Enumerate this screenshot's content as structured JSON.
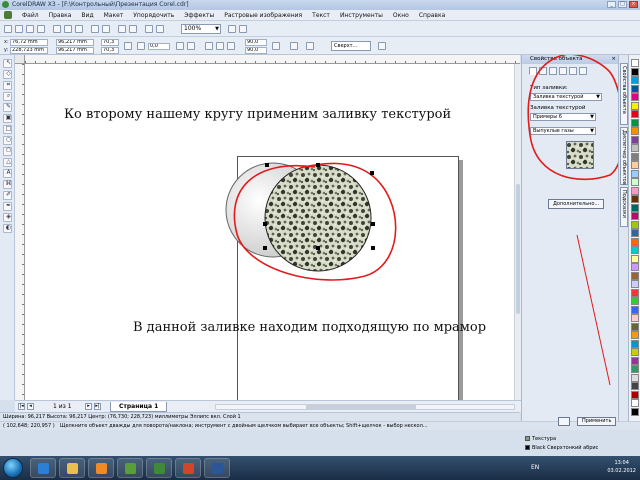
{
  "window": {
    "title": "CorelDRAW X3 - [F:\\Контрольный\\Презентация Corel.cdr]",
    "controls": [
      "_",
      "□",
      "×"
    ]
  },
  "menu": [
    "Файл",
    "Правка",
    "Вид",
    "Макет",
    "Упорядочить",
    "Эффекты",
    "Растровые изображения",
    "Текст",
    "Инструменты",
    "Окно",
    "Справка"
  ],
  "property_bar": {
    "zoom": "100%",
    "x": "76,72 mm",
    "y": "228,723 mm",
    "width": "96,217 mm",
    "height": "96,217 mm",
    "scale_w": "70,3",
    "scale_h": "70,3",
    "angle": "0,0",
    "arc_start": "90,0",
    "arc_end": "90,0",
    "outline_style": "Сверхт..."
  },
  "canvas": {
    "caption_top": "Ко второму нашему кругу применим заливку текстурой",
    "caption_bottom": "В данной заливке находим подходящую по мрамор"
  },
  "page_nav": {
    "count": "1 из 1",
    "tab": "Страница 1",
    "first": "|◂",
    "prev": "◂",
    "next": "▸",
    "last": "▸|"
  },
  "status": {
    "line1": "Ширина: 96,217 Высота: 96,217 Центр: (76,730; 228,723) миллиметры      Эллипс вкл. Слой 1",
    "coords": "( 102,648; 220,957 )",
    "hint": "Щелкните объект дважды для поворота/наклона; инструмент с двойным щелчком выбирает все объекты; Shift+щелчок - выбор нескол...",
    "fill_name": "Текстура",
    "outline_name": "Black  Сверхтонкий абрис"
  },
  "docker": {
    "title": "Свойства объекта",
    "fill_type_label": "Тип заливки:",
    "fill_type_value": "Заливка текстурой",
    "library_label": "Заливка текстурой",
    "library_value": "Примеры 6",
    "texture_value": "Выпуклые газы",
    "more_button": "Дополнительно...",
    "apply_button": "Применить"
  },
  "vertical_tabs": [
    "Свойства объекта",
    "Диспетчер объектов",
    "Подсказки"
  ],
  "palette": [
    "#ffffff",
    "#000000",
    "#00a0e0",
    "#0055a5",
    "#e5007e",
    "#ffed00",
    "#e30613",
    "#009640",
    "#f39200",
    "#7f3f98",
    "#bfbfbf",
    "#808080",
    "#ffcc99",
    "#99ccff",
    "#ccffcc",
    "#ff99cc",
    "#663300",
    "#006666",
    "#cc0066",
    "#99cc00",
    "#336699",
    "#ff6600",
    "#00cccc",
    "#ffff99",
    "#cc99ff",
    "#996633",
    "#ccccff",
    "#ff3333",
    "#33cc33",
    "#3366ff",
    "#ffcccc",
    "#666633",
    "#ff9900",
    "#0099cc",
    "#cccc00",
    "#993399",
    "#339966",
    "#dddddd",
    "#444444",
    "#aa0000",
    "#ffffff",
    "#000000"
  ],
  "taskbar": {
    "lang": "EN",
    "time": "13:04",
    "date": "03.02.2012"
  },
  "colors": {
    "annotation_red": "#e21b1b",
    "title_bar": "#b3c7e4",
    "taskbar": "#1a2d46"
  }
}
